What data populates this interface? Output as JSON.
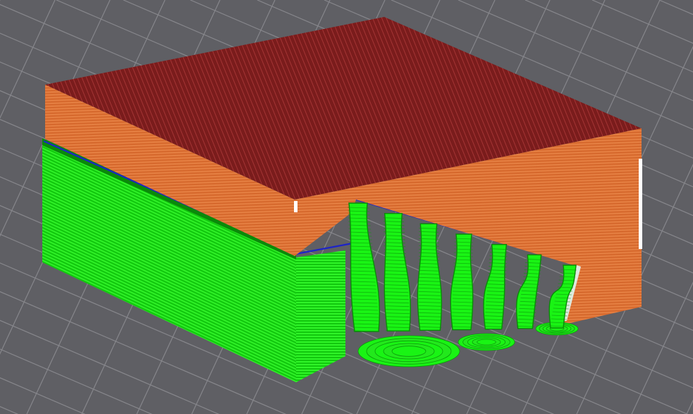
{
  "viewport": {
    "background_color": "#5f5f64",
    "grid_color": "#8d8d92"
  },
  "model": {
    "feature_colors": {
      "top_solid_infill": "#8e2424",
      "perimeter": "#e07032",
      "support_material": "#19f414",
      "bridge_interface": "#1d24c8",
      "wipe_marker": "#ffffff"
    },
    "support_trees": 7
  }
}
